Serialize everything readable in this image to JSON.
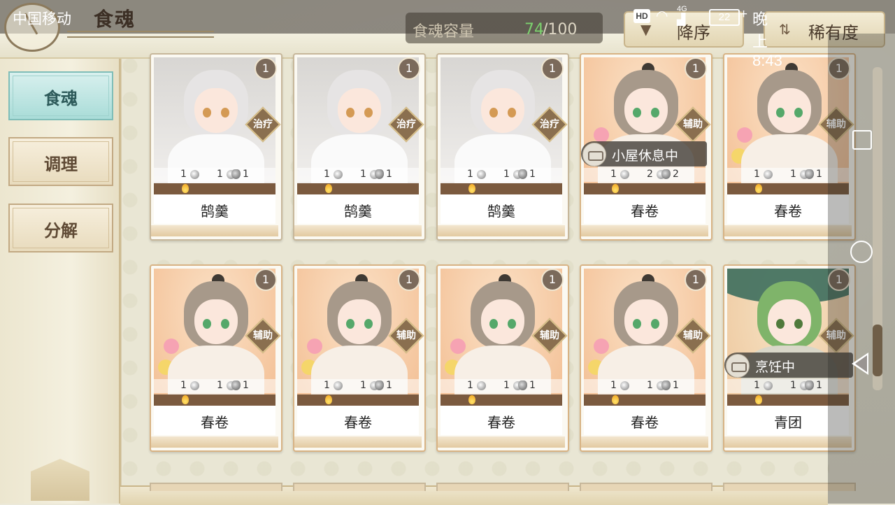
{
  "status_bar": {
    "carrier": "中国移动",
    "hd_badge": "HD",
    "network": "4G",
    "battery": "22",
    "time": "晚上8:43"
  },
  "header": {
    "title": "食魂",
    "capacity_label": "食魂容量",
    "capacity_current": "74",
    "capacity_max": "/100",
    "sort_order_label": "降序",
    "sort_field_label": "稀有度"
  },
  "menu": {
    "items": [
      {
        "label": "食魂",
        "active": true
      },
      {
        "label": "调理",
        "active": false
      },
      {
        "label": "分解",
        "active": false
      }
    ]
  },
  "cards": [
    {
      "name": "鹄羹",
      "role": "治疗",
      "level": "1",
      "stats": [
        "1",
        "1",
        "1"
      ],
      "style": "silver",
      "state": ""
    },
    {
      "name": "鹄羹",
      "role": "治疗",
      "level": "1",
      "stats": [
        "1",
        "1",
        "1"
      ],
      "style": "silver",
      "state": ""
    },
    {
      "name": "鹄羹",
      "role": "治疗",
      "level": "1",
      "stats": [
        "1",
        "1",
        "1"
      ],
      "style": "silver",
      "state": ""
    },
    {
      "name": "春卷",
      "role": "辅助",
      "level": "1",
      "stats": [
        "1",
        "2",
        "2"
      ],
      "style": "gold",
      "state": "小屋休息中"
    },
    {
      "name": "春卷",
      "role": "辅助",
      "level": "1",
      "stats": [
        "1",
        "1",
        "1"
      ],
      "style": "gold",
      "state": ""
    },
    {
      "name": "春卷",
      "role": "辅助",
      "level": "1",
      "stats": [
        "1",
        "1",
        "1"
      ],
      "style": "gold",
      "state": ""
    },
    {
      "name": "春卷",
      "role": "辅助",
      "level": "1",
      "stats": [
        "1",
        "1",
        "1"
      ],
      "style": "gold",
      "state": ""
    },
    {
      "name": "春卷",
      "role": "辅助",
      "level": "1",
      "stats": [
        "1",
        "1",
        "1"
      ],
      "style": "gold",
      "state": ""
    },
    {
      "name": "春卷",
      "role": "辅助",
      "level": "1",
      "stats": [
        "1",
        "1",
        "1"
      ],
      "style": "gold",
      "state": ""
    },
    {
      "name": "青团",
      "role": "辅助",
      "level": "1",
      "stats": [
        "1",
        "1",
        "1"
      ],
      "style": "green",
      "state": "烹饪中"
    }
  ],
  "icons": {
    "sort_order": "chevron-down-icon",
    "sort_field": "sort-arrows-icon",
    "state": "bowl-icon",
    "nav_recents": "square-icon",
    "nav_home": "circle-icon",
    "nav_back": "triangle-back-icon"
  },
  "colors": {
    "capacity_current": "#7bd16e",
    "menu_active": "#a9dcd8",
    "card_border": "#d8b384"
  }
}
